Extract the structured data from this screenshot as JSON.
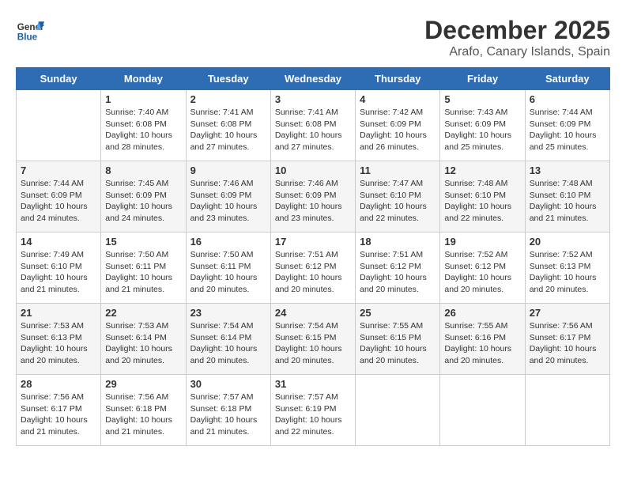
{
  "header": {
    "logo_line1": "General",
    "logo_line2": "Blue",
    "month": "December 2025",
    "location": "Arafo, Canary Islands, Spain"
  },
  "days_of_week": [
    "Sunday",
    "Monday",
    "Tuesday",
    "Wednesday",
    "Thursday",
    "Friday",
    "Saturday"
  ],
  "weeks": [
    [
      {
        "day": "",
        "info": ""
      },
      {
        "day": "1",
        "info": "Sunrise: 7:40 AM\nSunset: 6:08 PM\nDaylight: 10 hours\nand 28 minutes."
      },
      {
        "day": "2",
        "info": "Sunrise: 7:41 AM\nSunset: 6:08 PM\nDaylight: 10 hours\nand 27 minutes."
      },
      {
        "day": "3",
        "info": "Sunrise: 7:41 AM\nSunset: 6:08 PM\nDaylight: 10 hours\nand 27 minutes."
      },
      {
        "day": "4",
        "info": "Sunrise: 7:42 AM\nSunset: 6:09 PM\nDaylight: 10 hours\nand 26 minutes."
      },
      {
        "day": "5",
        "info": "Sunrise: 7:43 AM\nSunset: 6:09 PM\nDaylight: 10 hours\nand 25 minutes."
      },
      {
        "day": "6",
        "info": "Sunrise: 7:44 AM\nSunset: 6:09 PM\nDaylight: 10 hours\nand 25 minutes."
      }
    ],
    [
      {
        "day": "7",
        "info": "Sunrise: 7:44 AM\nSunset: 6:09 PM\nDaylight: 10 hours\nand 24 minutes."
      },
      {
        "day": "8",
        "info": "Sunrise: 7:45 AM\nSunset: 6:09 PM\nDaylight: 10 hours\nand 24 minutes."
      },
      {
        "day": "9",
        "info": "Sunrise: 7:46 AM\nSunset: 6:09 PM\nDaylight: 10 hours\nand 23 minutes."
      },
      {
        "day": "10",
        "info": "Sunrise: 7:46 AM\nSunset: 6:09 PM\nDaylight: 10 hours\nand 23 minutes."
      },
      {
        "day": "11",
        "info": "Sunrise: 7:47 AM\nSunset: 6:10 PM\nDaylight: 10 hours\nand 22 minutes."
      },
      {
        "day": "12",
        "info": "Sunrise: 7:48 AM\nSunset: 6:10 PM\nDaylight: 10 hours\nand 22 minutes."
      },
      {
        "day": "13",
        "info": "Sunrise: 7:48 AM\nSunset: 6:10 PM\nDaylight: 10 hours\nand 21 minutes."
      }
    ],
    [
      {
        "day": "14",
        "info": "Sunrise: 7:49 AM\nSunset: 6:10 PM\nDaylight: 10 hours\nand 21 minutes."
      },
      {
        "day": "15",
        "info": "Sunrise: 7:50 AM\nSunset: 6:11 PM\nDaylight: 10 hours\nand 21 minutes."
      },
      {
        "day": "16",
        "info": "Sunrise: 7:50 AM\nSunset: 6:11 PM\nDaylight: 10 hours\nand 20 minutes."
      },
      {
        "day": "17",
        "info": "Sunrise: 7:51 AM\nSunset: 6:12 PM\nDaylight: 10 hours\nand 20 minutes."
      },
      {
        "day": "18",
        "info": "Sunrise: 7:51 AM\nSunset: 6:12 PM\nDaylight: 10 hours\nand 20 minutes."
      },
      {
        "day": "19",
        "info": "Sunrise: 7:52 AM\nSunset: 6:12 PM\nDaylight: 10 hours\nand 20 minutes."
      },
      {
        "day": "20",
        "info": "Sunrise: 7:52 AM\nSunset: 6:13 PM\nDaylight: 10 hours\nand 20 minutes."
      }
    ],
    [
      {
        "day": "21",
        "info": "Sunrise: 7:53 AM\nSunset: 6:13 PM\nDaylight: 10 hours\nand 20 minutes."
      },
      {
        "day": "22",
        "info": "Sunrise: 7:53 AM\nSunset: 6:14 PM\nDaylight: 10 hours\nand 20 minutes."
      },
      {
        "day": "23",
        "info": "Sunrise: 7:54 AM\nSunset: 6:14 PM\nDaylight: 10 hours\nand 20 minutes."
      },
      {
        "day": "24",
        "info": "Sunrise: 7:54 AM\nSunset: 6:15 PM\nDaylight: 10 hours\nand 20 minutes."
      },
      {
        "day": "25",
        "info": "Sunrise: 7:55 AM\nSunset: 6:15 PM\nDaylight: 10 hours\nand 20 minutes."
      },
      {
        "day": "26",
        "info": "Sunrise: 7:55 AM\nSunset: 6:16 PM\nDaylight: 10 hours\nand 20 minutes."
      },
      {
        "day": "27",
        "info": "Sunrise: 7:56 AM\nSunset: 6:17 PM\nDaylight: 10 hours\nand 20 minutes."
      }
    ],
    [
      {
        "day": "28",
        "info": "Sunrise: 7:56 AM\nSunset: 6:17 PM\nDaylight: 10 hours\nand 21 minutes."
      },
      {
        "day": "29",
        "info": "Sunrise: 7:56 AM\nSunset: 6:18 PM\nDaylight: 10 hours\nand 21 minutes."
      },
      {
        "day": "30",
        "info": "Sunrise: 7:57 AM\nSunset: 6:18 PM\nDaylight: 10 hours\nand 21 minutes."
      },
      {
        "day": "31",
        "info": "Sunrise: 7:57 AM\nSunset: 6:19 PM\nDaylight: 10 hours\nand 22 minutes."
      },
      {
        "day": "",
        "info": ""
      },
      {
        "day": "",
        "info": ""
      },
      {
        "day": "",
        "info": ""
      }
    ]
  ]
}
